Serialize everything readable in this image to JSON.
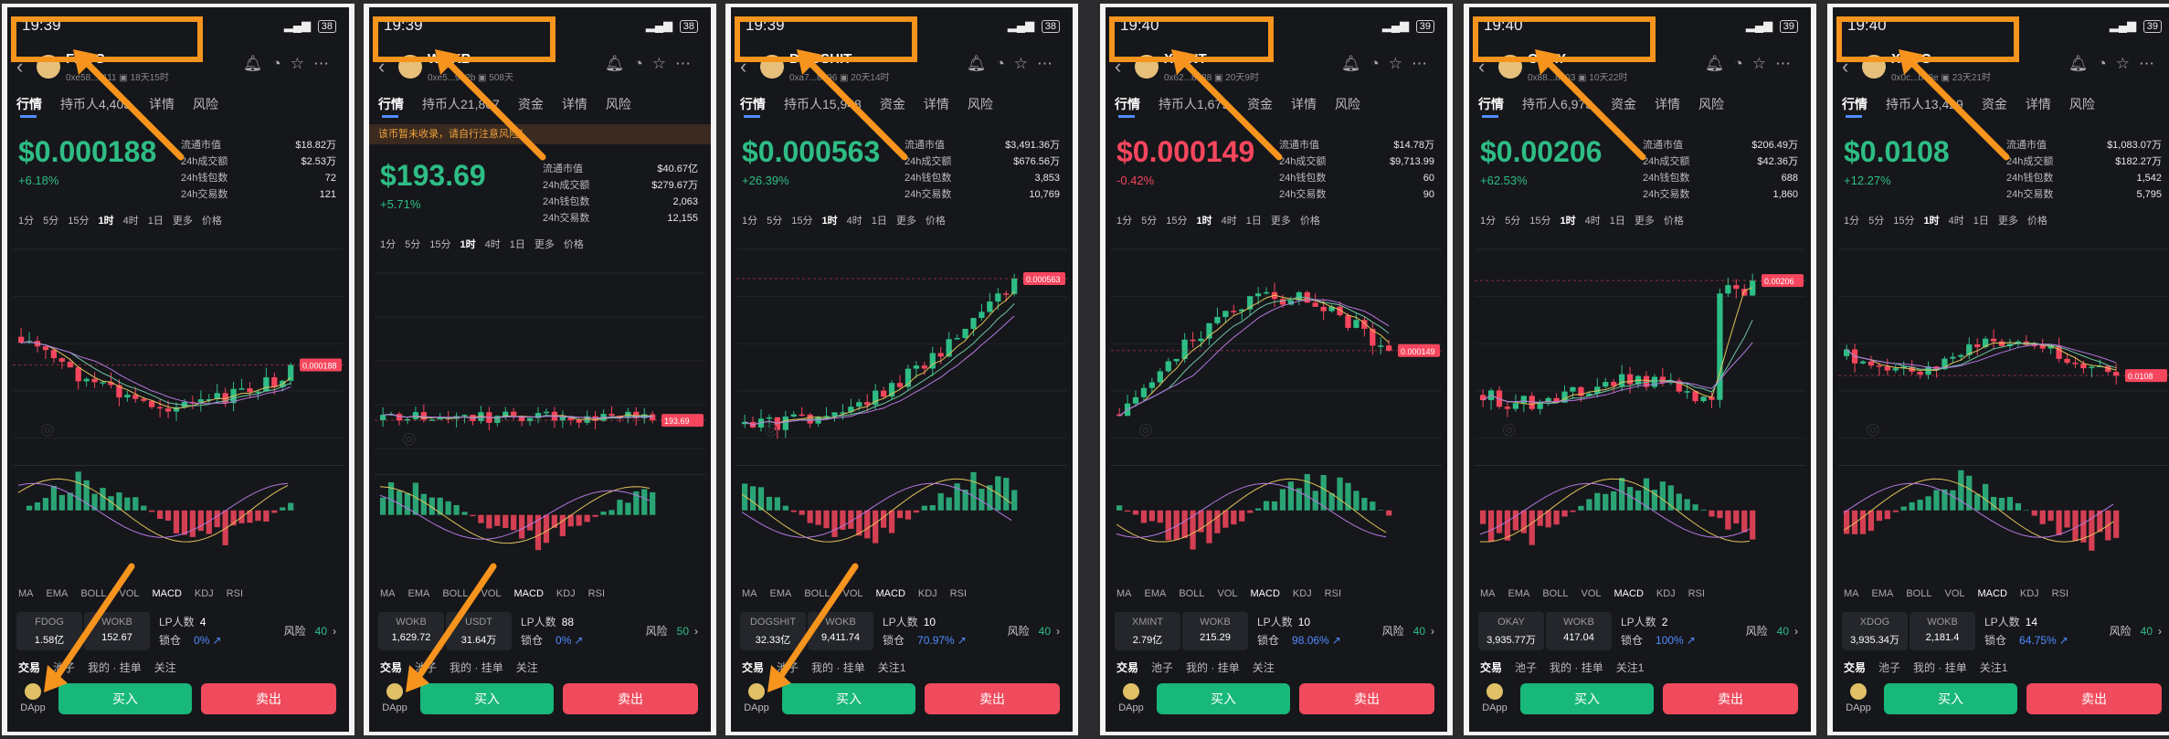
{
  "panels": [
    {
      "time": "19:39",
      "battery": "38",
      "token": "FDOG",
      "address": "0xe58...1111",
      "age": "18天15时",
      "tabs": [
        "行情",
        "持币人4,403",
        "详情",
        "风险"
      ],
      "price": "$0.000188",
      "change": "+6.18%",
      "direction": "up",
      "stats": [
        {
          "label": "流通市值",
          "value": "$18.82万"
        },
        {
          "label": "24h成交额",
          "value": "$2.53万"
        },
        {
          "label": "24h钱包数",
          "value": "72"
        },
        {
          "label": "24h交易数",
          "value": "121"
        }
      ],
      "timeframes": [
        "1分",
        "5分",
        "15分",
        "1时",
        "4时",
        "1日",
        "更多",
        "价格"
      ],
      "indicators": [
        "MA",
        "EMA",
        "BOLL",
        "VOL",
        "MACD",
        "KDJ",
        "RSI"
      ],
      "price_tag": "0.000188",
      "pair_base": "FDOG",
      "pair_base_value": "1.58亿",
      "pair_quote": "WOKB",
      "pair_quote_value": "152.67",
      "lp_label": "LP人数",
      "lp_count": "4",
      "lock_label": "锁仓",
      "lock_value": "0%",
      "risk_label": "风险",
      "risk_value": "40",
      "bottom_tabs": [
        "交易",
        "池子",
        "我的 · 挂单",
        "关注"
      ],
      "buy": "买入",
      "sell": "卖出",
      "dapp": "DApp"
    },
    {
      "time": "19:39",
      "battery": "38",
      "token": "WOKB",
      "address": "0xe5...9b2b",
      "age": "508天",
      "tabs": [
        "行情",
        "持币人21,807",
        "资金",
        "详情",
        "风险"
      ],
      "warning": "该币暂未收录，请自行注意风险！",
      "price": "$193.69",
      "change": "+5.71%",
      "direction": "up",
      "stats": [
        {
          "label": "流通市值",
          "value": "$40.67亿"
        },
        {
          "label": "24h成交额",
          "value": "$279.67万"
        },
        {
          "label": "24h钱包数",
          "value": "2,063"
        },
        {
          "label": "24h交易数",
          "value": "12,155"
        }
      ],
      "timeframes": [
        "1分",
        "5分",
        "15分",
        "1时",
        "4时",
        "1日",
        "更多",
        "价格"
      ],
      "indicators": [
        "MA",
        "EMA",
        "BOLL",
        "VOL",
        "MACD",
        "KDJ",
        "RSI"
      ],
      "price_tag": "193.69",
      "pair_base": "WOKB",
      "pair_base_value": "1,629.72",
      "pair_quote": "USDT",
      "pair_quote_value": "31.64万",
      "lp_label": "LP人数",
      "lp_count": "88",
      "lock_label": "锁仓",
      "lock_value": "0%",
      "risk_label": "风险",
      "risk_value": "50",
      "bottom_tabs": [
        "交易",
        "池子",
        "我的 · 挂单",
        "关注"
      ],
      "buy": "买入",
      "sell": "卖出",
      "dapp": "DApp"
    },
    {
      "time": "19:39",
      "battery": "38",
      "token": "DOGSHIT",
      "address": "0xa7...8696",
      "age": "20天14时",
      "tabs": [
        "行情",
        "持币人15,948",
        "资金",
        "详情",
        "风险"
      ],
      "price": "$0.000563",
      "change": "+26.39%",
      "direction": "up",
      "stats": [
        {
          "label": "流通市值",
          "value": "$3,491.36万"
        },
        {
          "label": "24h成交额",
          "value": "$676.56万"
        },
        {
          "label": "24h钱包数",
          "value": "3,853"
        },
        {
          "label": "24h交易数",
          "value": "10,769"
        }
      ],
      "timeframes": [
        "1分",
        "5分",
        "15分",
        "1时",
        "4时",
        "1日",
        "更多",
        "价格"
      ],
      "indicators": [
        "MA",
        "EMA",
        "BOLL",
        "VOL",
        "MACD",
        "KDJ",
        "RSI"
      ],
      "price_tag": "0.000563",
      "pair_base": "DOGSHIT",
      "pair_base_value": "32.33亿",
      "pair_quote": "WOKB",
      "pair_quote_value": "9,411.74",
      "lp_label": "LP人数",
      "lp_count": "10",
      "lock_label": "锁仓",
      "lock_value": "70.97%",
      "risk_label": "风险",
      "risk_value": "40",
      "bottom_tabs": [
        "交易",
        "池子",
        "我的 · 挂单",
        "关注1"
      ],
      "buy": "买入",
      "sell": "卖出",
      "dapp": "DApp"
    },
    {
      "time": "19:40",
      "battery": "39",
      "token": "XMINT",
      "address": "0x62...8888",
      "age": "20天9时",
      "tabs": [
        "行情",
        "持币人1,679",
        "资金",
        "详情",
        "风险"
      ],
      "price": "$0.000149",
      "change": "-0.42%",
      "direction": "down",
      "stats": [
        {
          "label": "流通市值",
          "value": "$14.78万"
        },
        {
          "label": "24h成交额",
          "value": "$9,713.99"
        },
        {
          "label": "24h钱包数",
          "value": "60"
        },
        {
          "label": "24h交易数",
          "value": "90"
        }
      ],
      "timeframes": [
        "1分",
        "5分",
        "15分",
        "1时",
        "4时",
        "1日",
        "更多",
        "价格"
      ],
      "indicators": [
        "MA",
        "EMA",
        "BOLL",
        "VOL",
        "MACD",
        "KDJ",
        "RSI"
      ],
      "price_tag": "0.000149",
      "pair_base": "XMINT",
      "pair_base_value": "2.79亿",
      "pair_quote": "WOKB",
      "pair_quote_value": "215.29",
      "lp_label": "LP人数",
      "lp_count": "10",
      "lock_label": "锁仓",
      "lock_value": "98.06%",
      "risk_label": "风险",
      "risk_value": "40",
      "bottom_tabs": [
        "交易",
        "池子",
        "我的 · 挂单",
        "关注"
      ],
      "buy": "买入",
      "sell": "卖出",
      "dapp": "DApp"
    },
    {
      "time": "19:40",
      "battery": "39",
      "token": "OKAY",
      "address": "0x88...8e03",
      "age": "10天22时",
      "tabs": [
        "行情",
        "持币人6,973",
        "资金",
        "详情",
        "风险"
      ],
      "price": "$0.00206",
      "change": "+62.53%",
      "direction": "up",
      "stats": [
        {
          "label": "流通市值",
          "value": "$206.49万"
        },
        {
          "label": "24h成交额",
          "value": "$42.36万"
        },
        {
          "label": "24h钱包数",
          "value": "688"
        },
        {
          "label": "24h交易数",
          "value": "1,860"
        }
      ],
      "timeframes": [
        "1分",
        "5分",
        "15分",
        "1时",
        "4时",
        "1日",
        "更多",
        "价格"
      ],
      "indicators": [
        "MA",
        "EMA",
        "BOLL",
        "VOL",
        "MACD",
        "KDJ",
        "RSI"
      ],
      "price_tag": "0.00206",
      "pair_base": "OKAY",
      "pair_base_value": "3,935.77万",
      "pair_quote": "WOKB",
      "pair_quote_value": "417.04",
      "lp_label": "LP人数",
      "lp_count": "2",
      "lock_label": "锁仓",
      "lock_value": "100%",
      "risk_label": "风险",
      "risk_value": "40",
      "bottom_tabs": [
        "交易",
        "池子",
        "我的 · 挂单",
        "关注1"
      ],
      "buy": "买入",
      "sell": "卖出",
      "dapp": "DApp"
    },
    {
      "time": "19:40",
      "battery": "39",
      "token": "XDOG",
      "address": "0x0c...b48e",
      "age": "23天21时",
      "tabs": [
        "行情",
        "持币人13,429",
        "资金",
        "详情",
        "风险"
      ],
      "price": "$0.0108",
      "change": "+12.27%",
      "direction": "up",
      "stats": [
        {
          "label": "流通市值",
          "value": "$1,083.07万"
        },
        {
          "label": "24h成交额",
          "value": "$182.27万"
        },
        {
          "label": "24h钱包数",
          "value": "1,542"
        },
        {
          "label": "24h交易数",
          "value": "5,795"
        }
      ],
      "timeframes": [
        "1分",
        "5分",
        "15分",
        "1时",
        "4时",
        "1日",
        "更多",
        "价格"
      ],
      "indicators": [
        "MA",
        "EMA",
        "BOLL",
        "VOL",
        "MACD",
        "KDJ",
        "RSI"
      ],
      "price_tag": "0.0108",
      "pair_base": "XDOG",
      "pair_base_value": "3,935.34万",
      "pair_quote": "WOKB",
      "pair_quote_value": "2,181.4",
      "lp_label": "LP人数",
      "lp_count": "14",
      "lock_label": "锁仓",
      "lock_value": "64.75%",
      "risk_label": "风险",
      "risk_value": "40",
      "bottom_tabs": [
        "交易",
        "池子",
        "我的 · 挂单",
        "关注1"
      ],
      "buy": "买入",
      "sell": "卖出",
      "dapp": "DApp"
    }
  ],
  "colors": {
    "up": "#2ebd85",
    "down": "#f6465d",
    "highlight": "#f7941d",
    "accent": "#4f8cff"
  }
}
